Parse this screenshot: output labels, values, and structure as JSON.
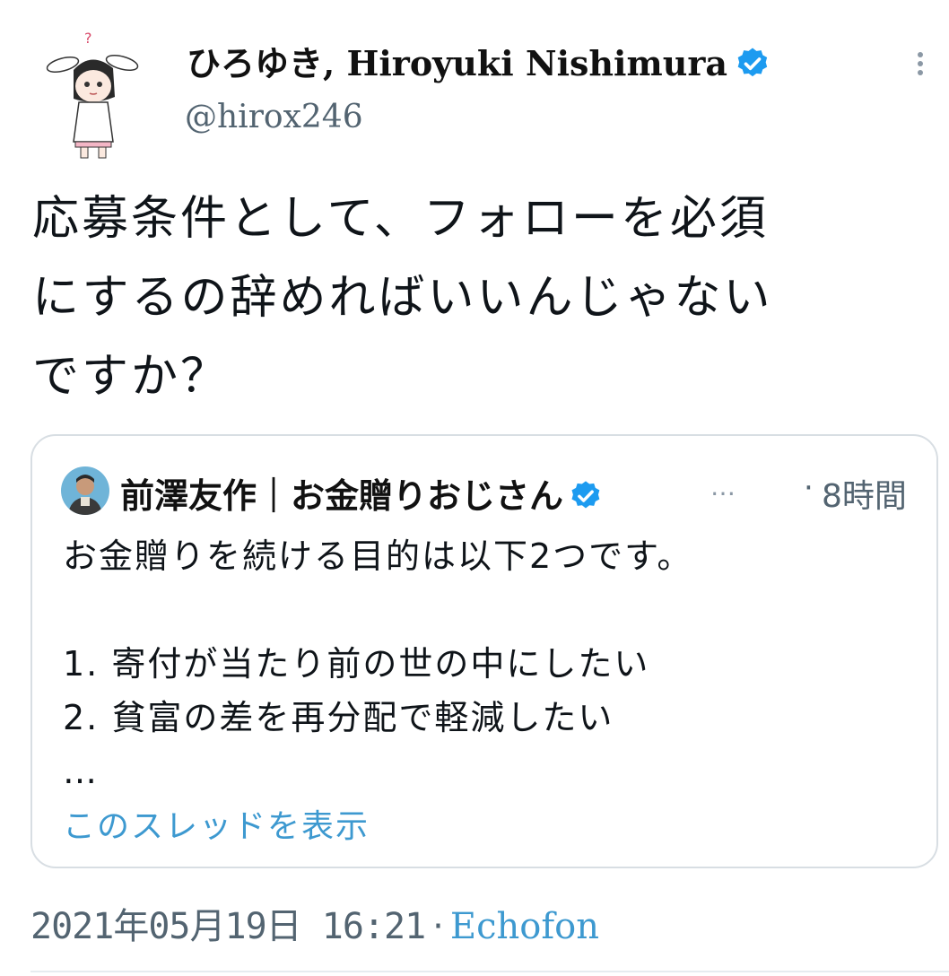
{
  "tweet": {
    "author_name": "ひろゆき, Hiroyuki Nishimura",
    "author_handle": "@hirox246",
    "text": "応募条件として、フォローを必須\nにするの辞めればいいんじゃない\nですか？",
    "date": "2021年05月19日 16:21",
    "separator": "·",
    "source": "Echofon",
    "more_icon": "more-vertical-icon",
    "verified_icon": "verified-badge-icon"
  },
  "quote": {
    "author_name": "前澤友作｜お金贈りおじさん",
    "ellipsis": "…",
    "separator": "·",
    "time": "8時間",
    "text": "お金贈りを続ける目的は以下2つです。\n\n1. 寄付が当たり前の世の中にしたい\n2. 貧富の差を再分配で軽減したい\n…",
    "show_thread": "このスレッドを表示"
  },
  "colors": {
    "verified": "#1d9bf0",
    "link": "#3d99d0",
    "secondary_text": "#536471",
    "border": "#d8dee3"
  }
}
